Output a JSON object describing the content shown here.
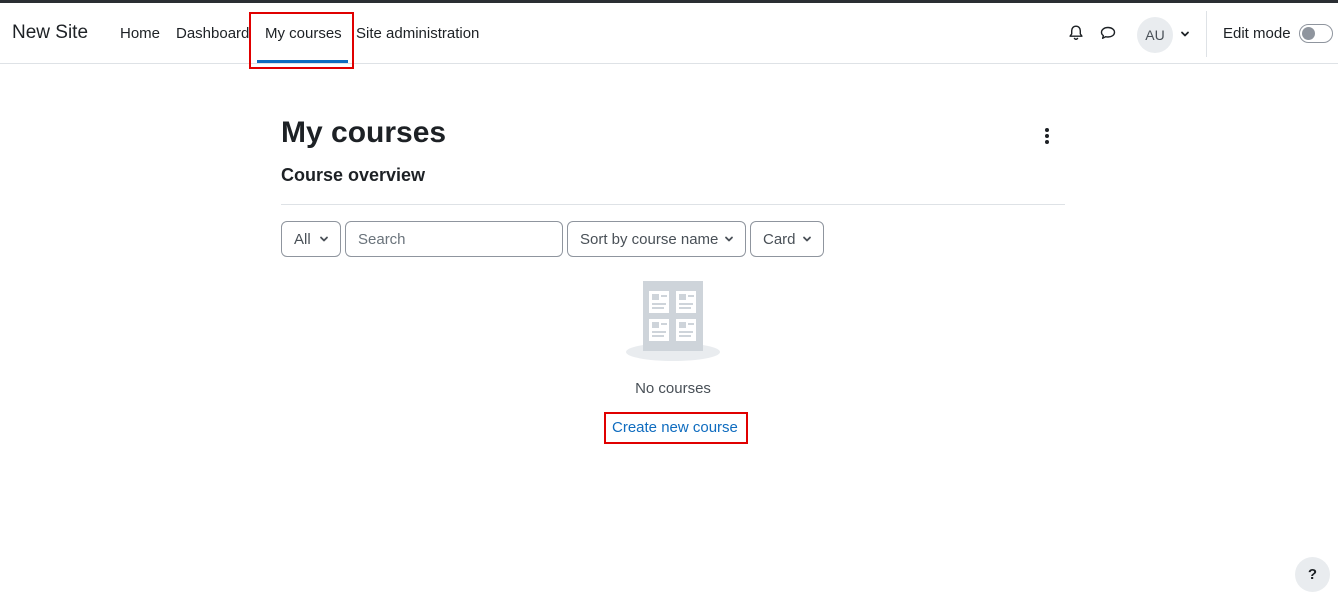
{
  "site": {
    "brand": "New Site"
  },
  "nav": {
    "items": [
      {
        "label": "Home"
      },
      {
        "label": "Dashboard"
      },
      {
        "label": "My courses",
        "active": true
      },
      {
        "label": "Site administration"
      }
    ]
  },
  "user": {
    "initials": "AU"
  },
  "edit_mode": {
    "label": "Edit mode",
    "on": false
  },
  "page": {
    "title": "My courses",
    "section_title": "Course overview"
  },
  "filters": {
    "grouping": "All",
    "search_placeholder": "Search",
    "sort": "Sort by course name",
    "view": "Card"
  },
  "empty": {
    "message": "No courses",
    "create_link": "Create new course"
  },
  "help": {
    "label": "?"
  },
  "colors": {
    "accent": "#0f6cbf",
    "highlight": "#e00000",
    "text": "#1d2125"
  },
  "icons": [
    "bell-icon",
    "chat-icon",
    "chevron-down-icon",
    "kebab-menu-icon",
    "empty-courses-icon"
  ]
}
